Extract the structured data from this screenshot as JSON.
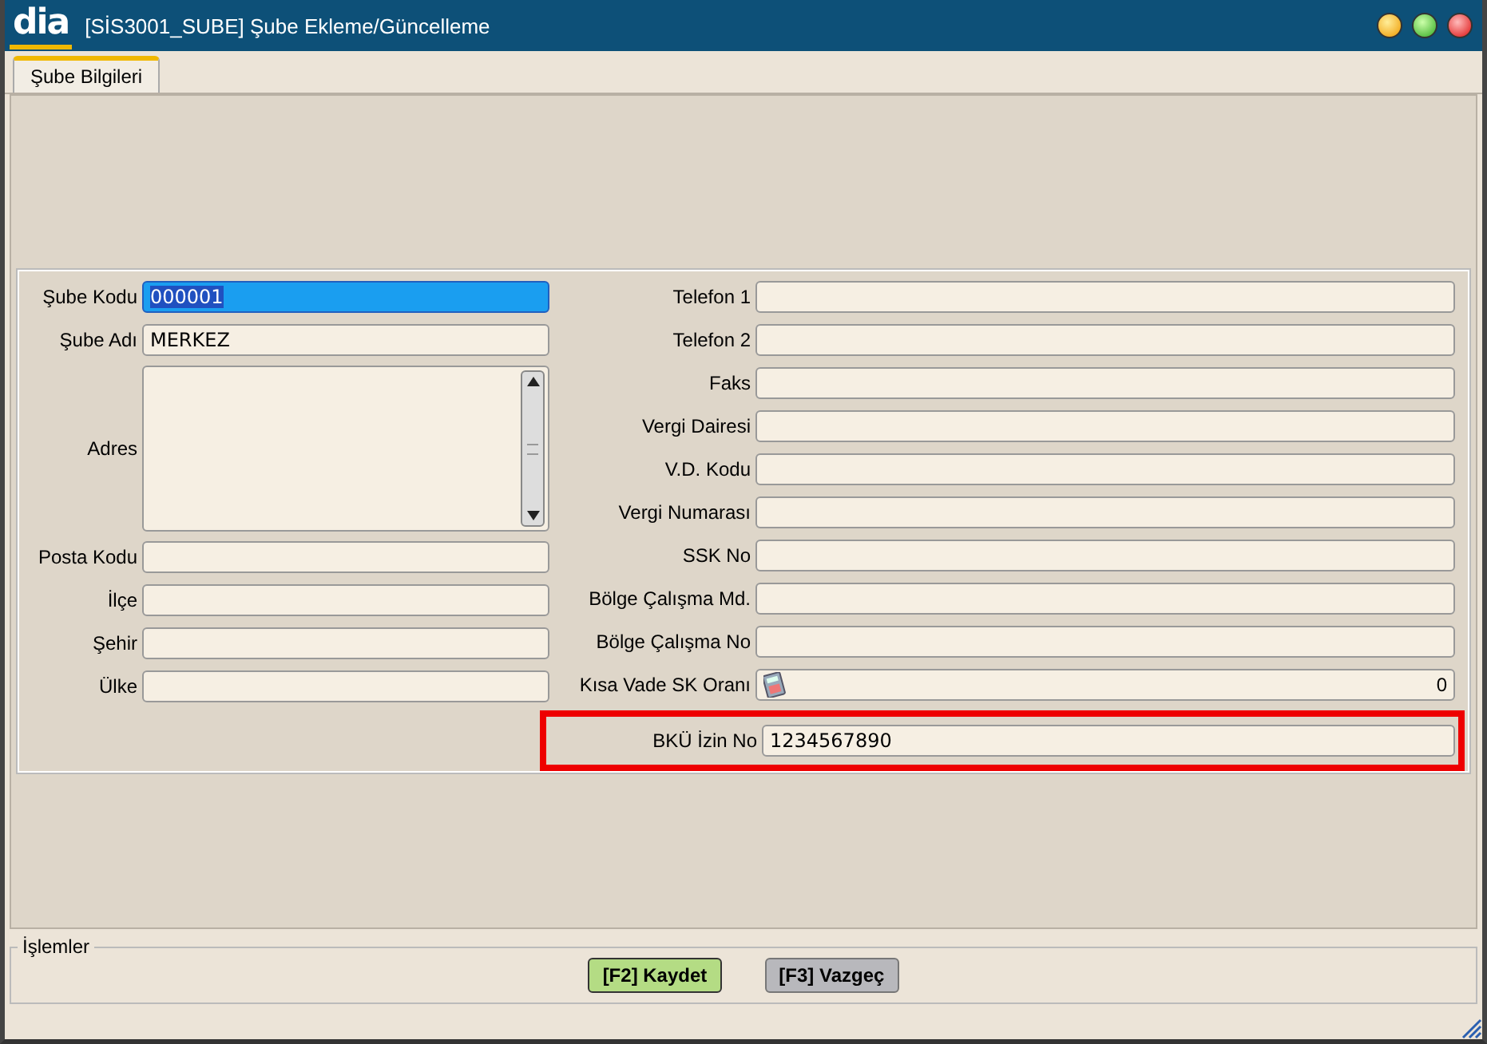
{
  "window": {
    "logo": "dia",
    "title": "[SİS3001_SUBE] Şube Ekleme/Güncelleme"
  },
  "tabs": [
    {
      "label": "Şube Bilgileri",
      "selected": true
    }
  ],
  "left_fields": [
    {
      "label": "Şube Kodu",
      "kind": "text",
      "value": "000001",
      "focused": true
    },
    {
      "label": "Şube Adı",
      "kind": "text",
      "value": "MERKEZ",
      "focused": false
    },
    {
      "label": "Adres",
      "kind": "textarea"
    },
    {
      "label": "Posta Kodu",
      "kind": "text",
      "focused": false
    },
    {
      "label": "İlçe",
      "kind": "text",
      "focused": false
    },
    {
      "label": "Şehir",
      "kind": "text",
      "focused": false
    },
    {
      "label": "Ülke",
      "kind": "text",
      "focused": false
    }
  ],
  "right_fields": [
    {
      "label": "Telefon 1",
      "kind": "text",
      "highlighted": false
    },
    {
      "label": "Telefon 2",
      "kind": "text",
      "highlighted": false
    },
    {
      "label": "Faks",
      "kind": "text",
      "highlighted": false
    },
    {
      "label": "Vergi Dairesi",
      "kind": "text",
      "highlighted": false
    },
    {
      "label": "V.D. Kodu",
      "kind": "text",
      "highlighted": false
    },
    {
      "label": "Vergi Numarası",
      "kind": "text",
      "highlighted": false
    },
    {
      "label": "SSK No",
      "kind": "text",
      "highlighted": false
    },
    {
      "label": "Bölge Çalışma Md.",
      "kind": "text",
      "highlighted": false
    },
    {
      "label": "Bölge Çalışma No",
      "kind": "text",
      "highlighted": false
    },
    {
      "label": "Kısa Vade SK Oranı",
      "kind": "numeric",
      "value": "0",
      "highlighted": false
    },
    {
      "label": "BKÜ İzin No",
      "kind": "text",
      "value": "1234567890",
      "highlighted": true
    }
  ],
  "actions": {
    "title": "İşlemler",
    "buttons": [
      {
        "label": "[F2] Kaydet",
        "kind": "primary"
      },
      {
        "label": "[F3] Vazgeç",
        "kind": "secondary"
      }
    ]
  }
}
